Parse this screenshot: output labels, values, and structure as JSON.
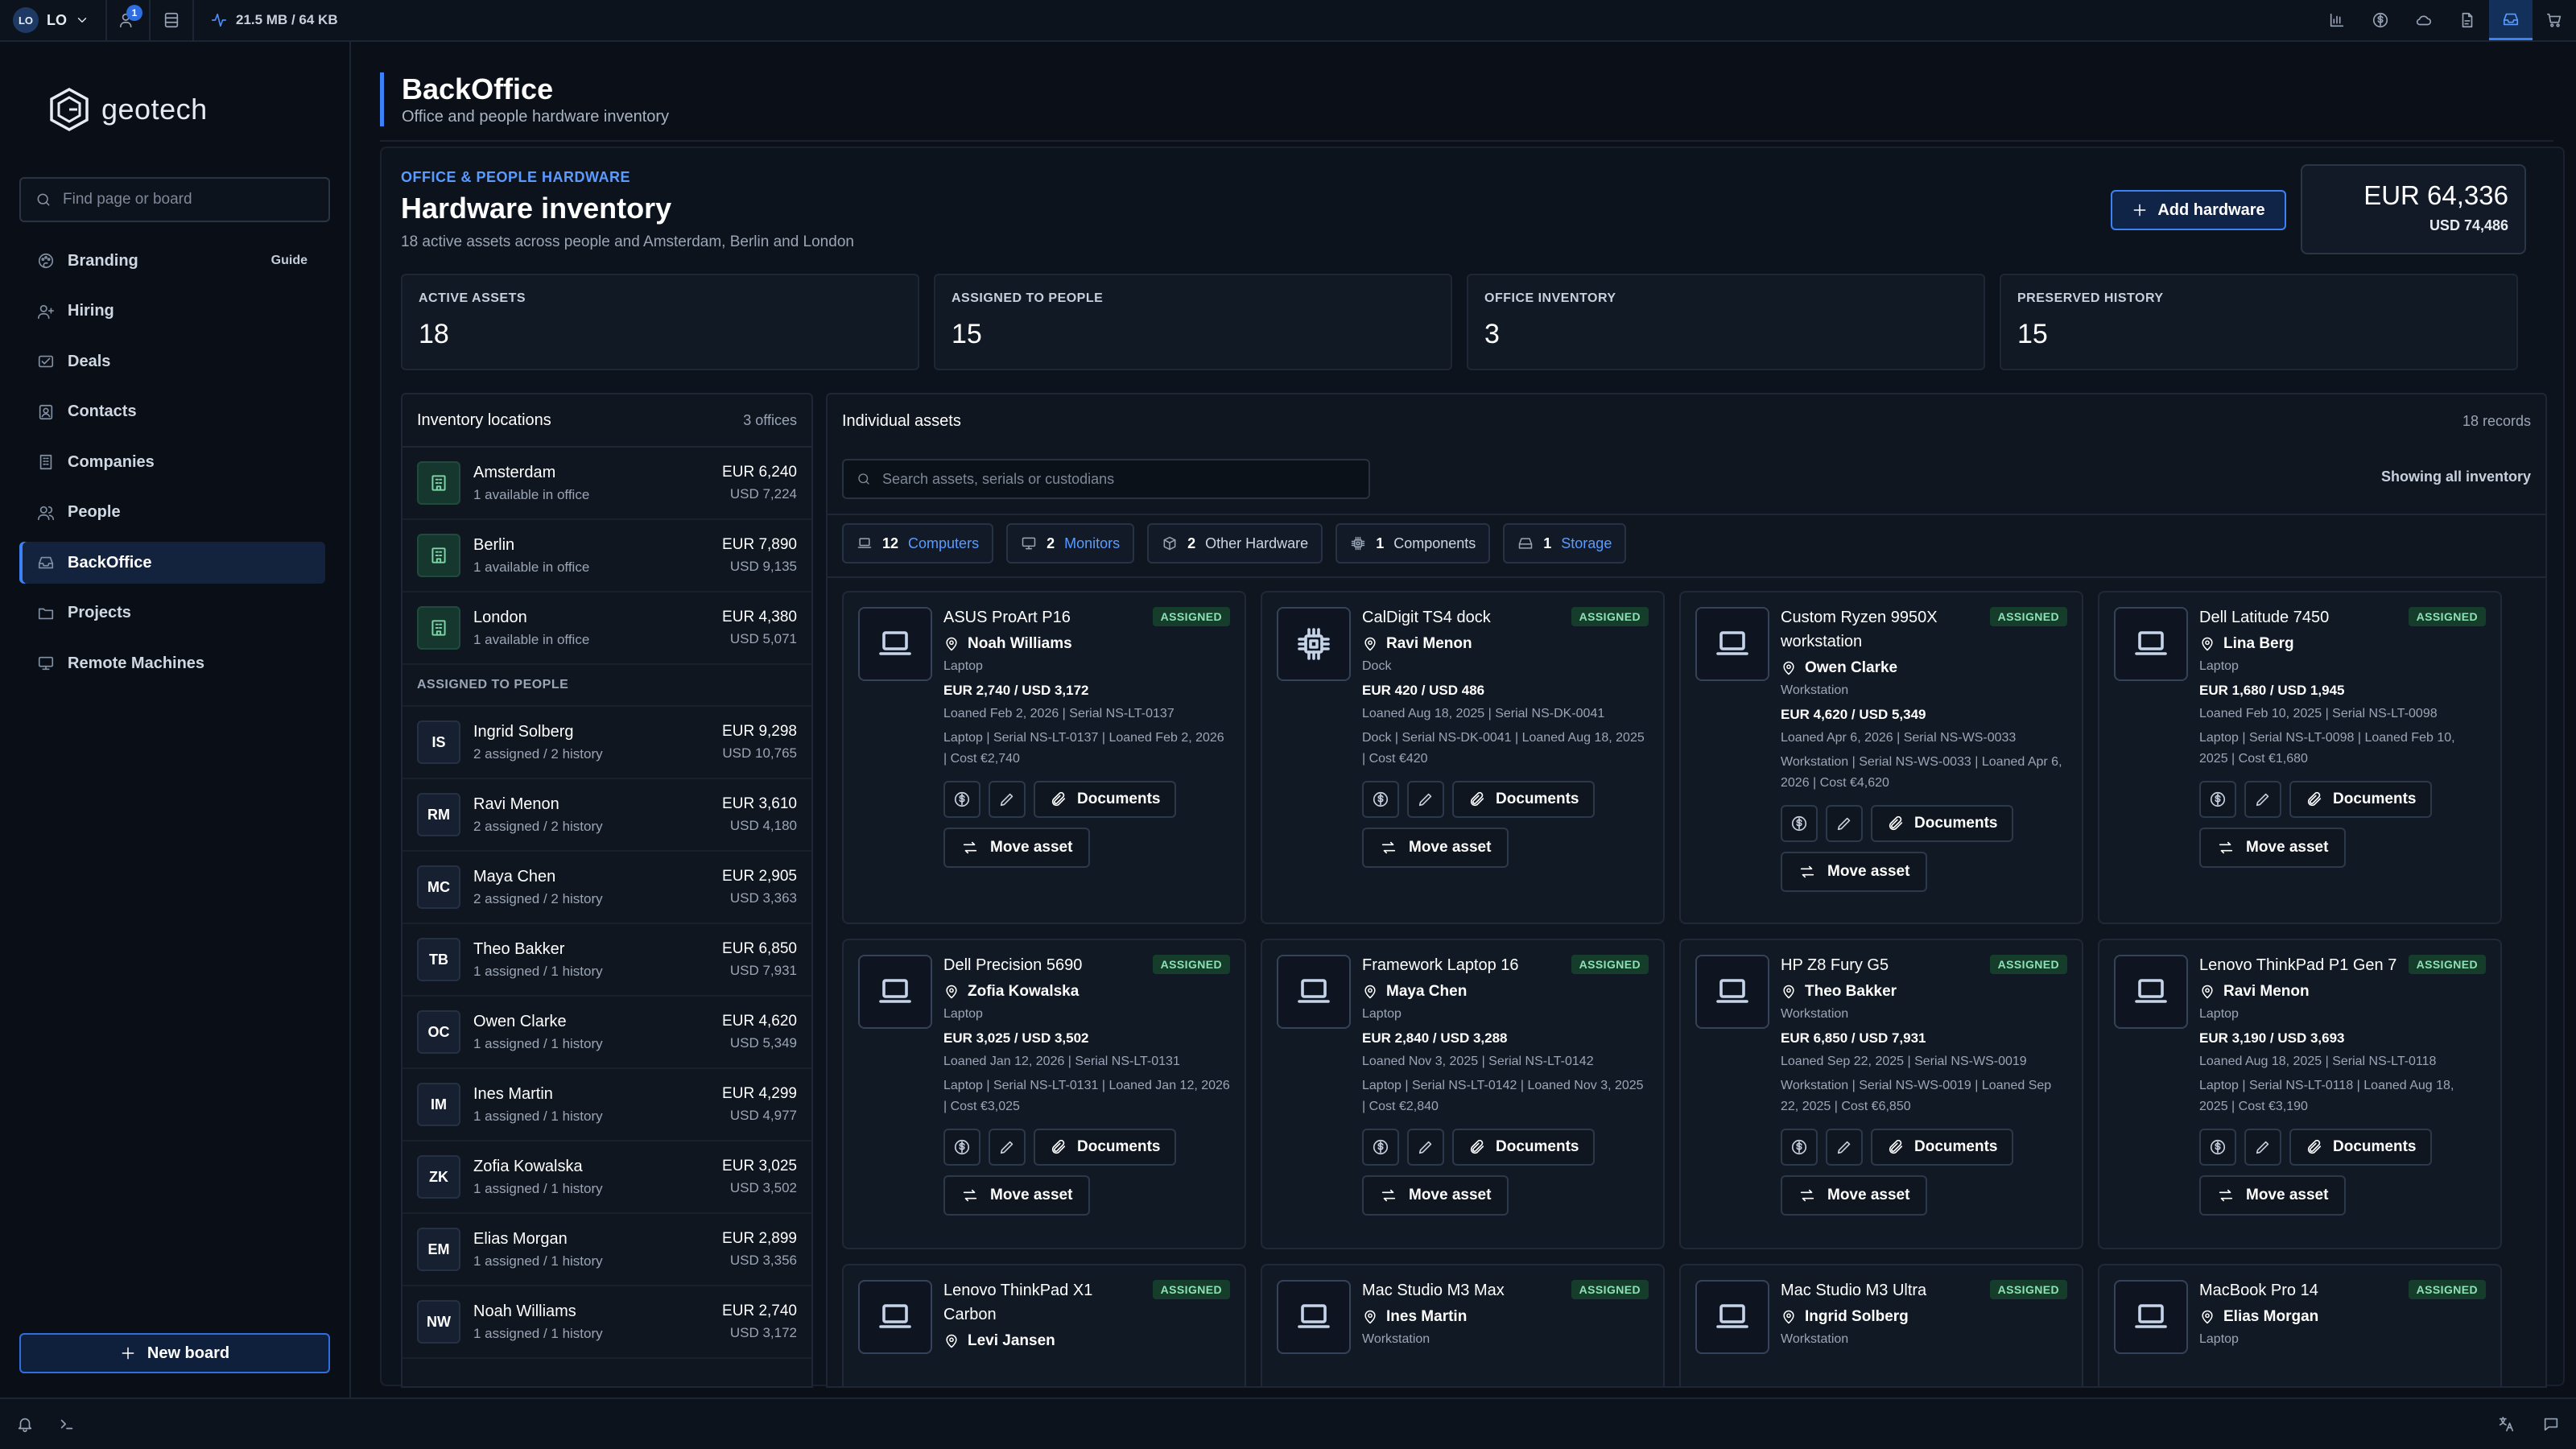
{
  "topbar": {
    "workspace_initials": "LO",
    "workspace_name": "LO",
    "notification_count": "1",
    "memory": "21.5 MB / 64 KB"
  },
  "sidebar": {
    "brand": "geotech",
    "search_placeholder": "Find page or board",
    "guide_label": "Guide",
    "items": [
      {
        "label": "Branding",
        "icon": "palette-icon"
      },
      {
        "label": "Hiring",
        "icon": "user-plus-icon"
      },
      {
        "label": "Deals",
        "icon": "handshake-icon"
      },
      {
        "label": "Contacts",
        "icon": "contact-card-icon"
      },
      {
        "label": "Companies",
        "icon": "building-icon"
      },
      {
        "label": "People",
        "icon": "people-icon"
      },
      {
        "label": "BackOffice",
        "icon": "inbox-icon"
      },
      {
        "label": "Projects",
        "icon": "folder-icon"
      },
      {
        "label": "Remote Machines",
        "icon": "monitor-icon"
      }
    ],
    "new_board_label": "New board"
  },
  "page": {
    "title": "BackOffice",
    "subtitle": "Office and people hardware inventory"
  },
  "inventory": {
    "eyebrow": "OFFICE & PEOPLE HARDWARE",
    "title": "Hardware inventory",
    "subtitle": "18 active assets across people and Amsterdam, Berlin and London",
    "add_label": "Add hardware",
    "total_eur": "EUR 64,336",
    "total_usd": "USD 74,486",
    "stats": [
      {
        "label": "ACTIVE ASSETS",
        "value": "18"
      },
      {
        "label": "ASSIGNED TO PEOPLE",
        "value": "15"
      },
      {
        "label": "OFFICE INVENTORY",
        "value": "3"
      },
      {
        "label": "PRESERVED HISTORY",
        "value": "15"
      }
    ]
  },
  "locations": {
    "title": "Inventory locations",
    "count": "3 offices",
    "offices": [
      {
        "name": "Amsterdam",
        "sub": "1 available in office",
        "eur": "EUR 6,240",
        "usd": "USD 7,224"
      },
      {
        "name": "Berlin",
        "sub": "1 available in office",
        "eur": "EUR 7,890",
        "usd": "USD 9,135"
      },
      {
        "name": "London",
        "sub": "1 available in office",
        "eur": "EUR 4,380",
        "usd": "USD 5,071"
      }
    ],
    "people_heading": "ASSIGNED TO PEOPLE",
    "people": [
      {
        "initials": "IS",
        "name": "Ingrid Solberg",
        "sub": "2 assigned / 2 history",
        "eur": "EUR 9,298",
        "usd": "USD 10,765"
      },
      {
        "initials": "RM",
        "name": "Ravi Menon",
        "sub": "2 assigned / 2 history",
        "eur": "EUR 3,610",
        "usd": "USD 4,180"
      },
      {
        "initials": "MC",
        "name": "Maya Chen",
        "sub": "2 assigned / 2 history",
        "eur": "EUR 2,905",
        "usd": "USD 3,363"
      },
      {
        "initials": "TB",
        "name": "Theo Bakker",
        "sub": "1 assigned / 1 history",
        "eur": "EUR 6,850",
        "usd": "USD 7,931"
      },
      {
        "initials": "OC",
        "name": "Owen Clarke",
        "sub": "1 assigned / 1 history",
        "eur": "EUR 4,620",
        "usd": "USD 5,349"
      },
      {
        "initials": "IM",
        "name": "Ines Martin",
        "sub": "1 assigned / 1 history",
        "eur": "EUR 4,299",
        "usd": "USD 4,977"
      },
      {
        "initials": "ZK",
        "name": "Zofia Kowalska",
        "sub": "1 assigned / 1 history",
        "eur": "EUR 3,025",
        "usd": "USD 3,502"
      },
      {
        "initials": "EM",
        "name": "Elias Morgan",
        "sub": "1 assigned / 1 history",
        "eur": "EUR 2,899",
        "usd": "USD 3,356"
      },
      {
        "initials": "NW",
        "name": "Noah Williams",
        "sub": "1 assigned / 1 history",
        "eur": "EUR 2,740",
        "usd": "USD 3,172"
      }
    ]
  },
  "assets": {
    "title": "Individual assets",
    "count": "18 records",
    "search_placeholder": "Search assets, serials or custodians",
    "showing": "Showing all inventory",
    "documents_label": "Documents",
    "move_label": "Move asset",
    "filters": [
      {
        "count": "12",
        "label": "Computers",
        "icon": "laptop-icon",
        "active": true
      },
      {
        "count": "2",
        "label": "Monitors",
        "icon": "monitor-icon",
        "active": true
      },
      {
        "count": "2",
        "label": "Other Hardware",
        "icon": "box-icon",
        "active": false
      },
      {
        "count": "1",
        "label": "Components",
        "icon": "chip-icon",
        "active": false
      },
      {
        "count": "1",
        "label": "Storage",
        "icon": "storage-icon",
        "active": true
      }
    ],
    "items": [
      {
        "name": "ASUS ProArt P16",
        "status": "ASSIGNED",
        "holder": "Noah Williams",
        "type": "Laptop",
        "cost": "EUR 2,740 / USD 3,172",
        "loan": "Loaned Feb 2, 2026 | Serial NS-LT-0137",
        "desc": "Laptop | Serial NS-LT-0137 | Loaned Feb 2, 2026 | Cost €2,740",
        "icon": "laptop-icon"
      },
      {
        "name": "CalDigit TS4 dock",
        "status": "ASSIGNED",
        "holder": "Ravi Menon",
        "type": "Dock",
        "cost": "EUR 420 / USD 486",
        "loan": "Loaned Aug 18, 2025 | Serial NS-DK-0041",
        "desc": "Dock | Serial NS-DK-0041 | Loaned Aug 18, 2025 | Cost €420",
        "icon": "chip-icon"
      },
      {
        "name": "Custom Ryzen 9950X workstation",
        "status": "ASSIGNED",
        "holder": "Owen Clarke",
        "type": "Workstation",
        "cost": "EUR 4,620 / USD 5,349",
        "loan": "Loaned Apr 6, 2026 | Serial NS-WS-0033",
        "desc": "Workstation | Serial NS-WS-0033 | Loaned Apr 6, 2026 | Cost €4,620",
        "icon": "laptop-icon"
      },
      {
        "name": "Dell Latitude 7450",
        "status": "ASSIGNED",
        "holder": "Lina Berg",
        "type": "Laptop",
        "cost": "EUR 1,680 / USD 1,945",
        "loan": "Loaned Feb 10, 2025 | Serial NS-LT-0098",
        "desc": "Laptop | Serial NS-LT-0098 | Loaned Feb 10, 2025 | Cost €1,680",
        "icon": "laptop-icon"
      },
      {
        "name": "Dell Precision 5690",
        "status": "ASSIGNED",
        "holder": "Zofia Kowalska",
        "type": "Laptop",
        "cost": "EUR 3,025 / USD 3,502",
        "loan": "Loaned Jan 12, 2026 | Serial NS-LT-0131",
        "desc": "Laptop | Serial NS-LT-0131 | Loaned Jan 12, 2026 | Cost €3,025",
        "icon": "laptop-icon"
      },
      {
        "name": "Framework Laptop 16",
        "status": "ASSIGNED",
        "holder": "Maya Chen",
        "type": "Laptop",
        "cost": "EUR 2,840 / USD 3,288",
        "loan": "Loaned Nov 3, 2025 | Serial NS-LT-0142",
        "desc": "Laptop | Serial NS-LT-0142 | Loaned Nov 3, 2025 | Cost €2,840",
        "icon": "laptop-icon"
      },
      {
        "name": "HP Z8 Fury G5",
        "status": "ASSIGNED",
        "holder": "Theo Bakker",
        "type": "Workstation",
        "cost": "EUR 6,850 / USD 7,931",
        "loan": "Loaned Sep 22, 2025 | Serial NS-WS-0019",
        "desc": "Workstation | Serial NS-WS-0019 | Loaned Sep 22, 2025 | Cost €6,850",
        "icon": "laptop-icon"
      },
      {
        "name": "Lenovo ThinkPad P1 Gen 7",
        "status": "ASSIGNED",
        "holder": "Ravi Menon",
        "type": "Laptop",
        "cost": "EUR 3,190 / USD 3,693",
        "loan": "Loaned Aug 18, 2025 | Serial NS-LT-0118",
        "desc": "Laptop | Serial NS-LT-0118 | Loaned Aug 18, 2025 | Cost €3,190",
        "icon": "laptop-icon"
      },
      {
        "name": "Lenovo ThinkPad X1 Carbon",
        "status": "ASSIGNED",
        "holder": "Levi Jansen",
        "type": "",
        "cost": "",
        "loan": "",
        "desc": "",
        "icon": "laptop-icon"
      },
      {
        "name": "Mac Studio M3 Max",
        "status": "ASSIGNED",
        "holder": "Ines Martin",
        "type": "Workstation",
        "cost": "",
        "loan": "",
        "desc": "",
        "icon": "laptop-icon"
      },
      {
        "name": "Mac Studio M3 Ultra",
        "status": "ASSIGNED",
        "holder": "Ingrid Solberg",
        "type": "Workstation",
        "cost": "",
        "loan": "",
        "desc": "",
        "icon": "laptop-icon"
      },
      {
        "name": "MacBook Pro 14",
        "status": "ASSIGNED",
        "holder": "Elias Morgan",
        "type": "Laptop",
        "cost": "",
        "loan": "",
        "desc": "",
        "icon": "laptop-icon"
      }
    ]
  },
  "colors": {
    "accent": "#3b82f6",
    "assigned_badge": "#8be3b3",
    "background": "#0b1018"
  }
}
